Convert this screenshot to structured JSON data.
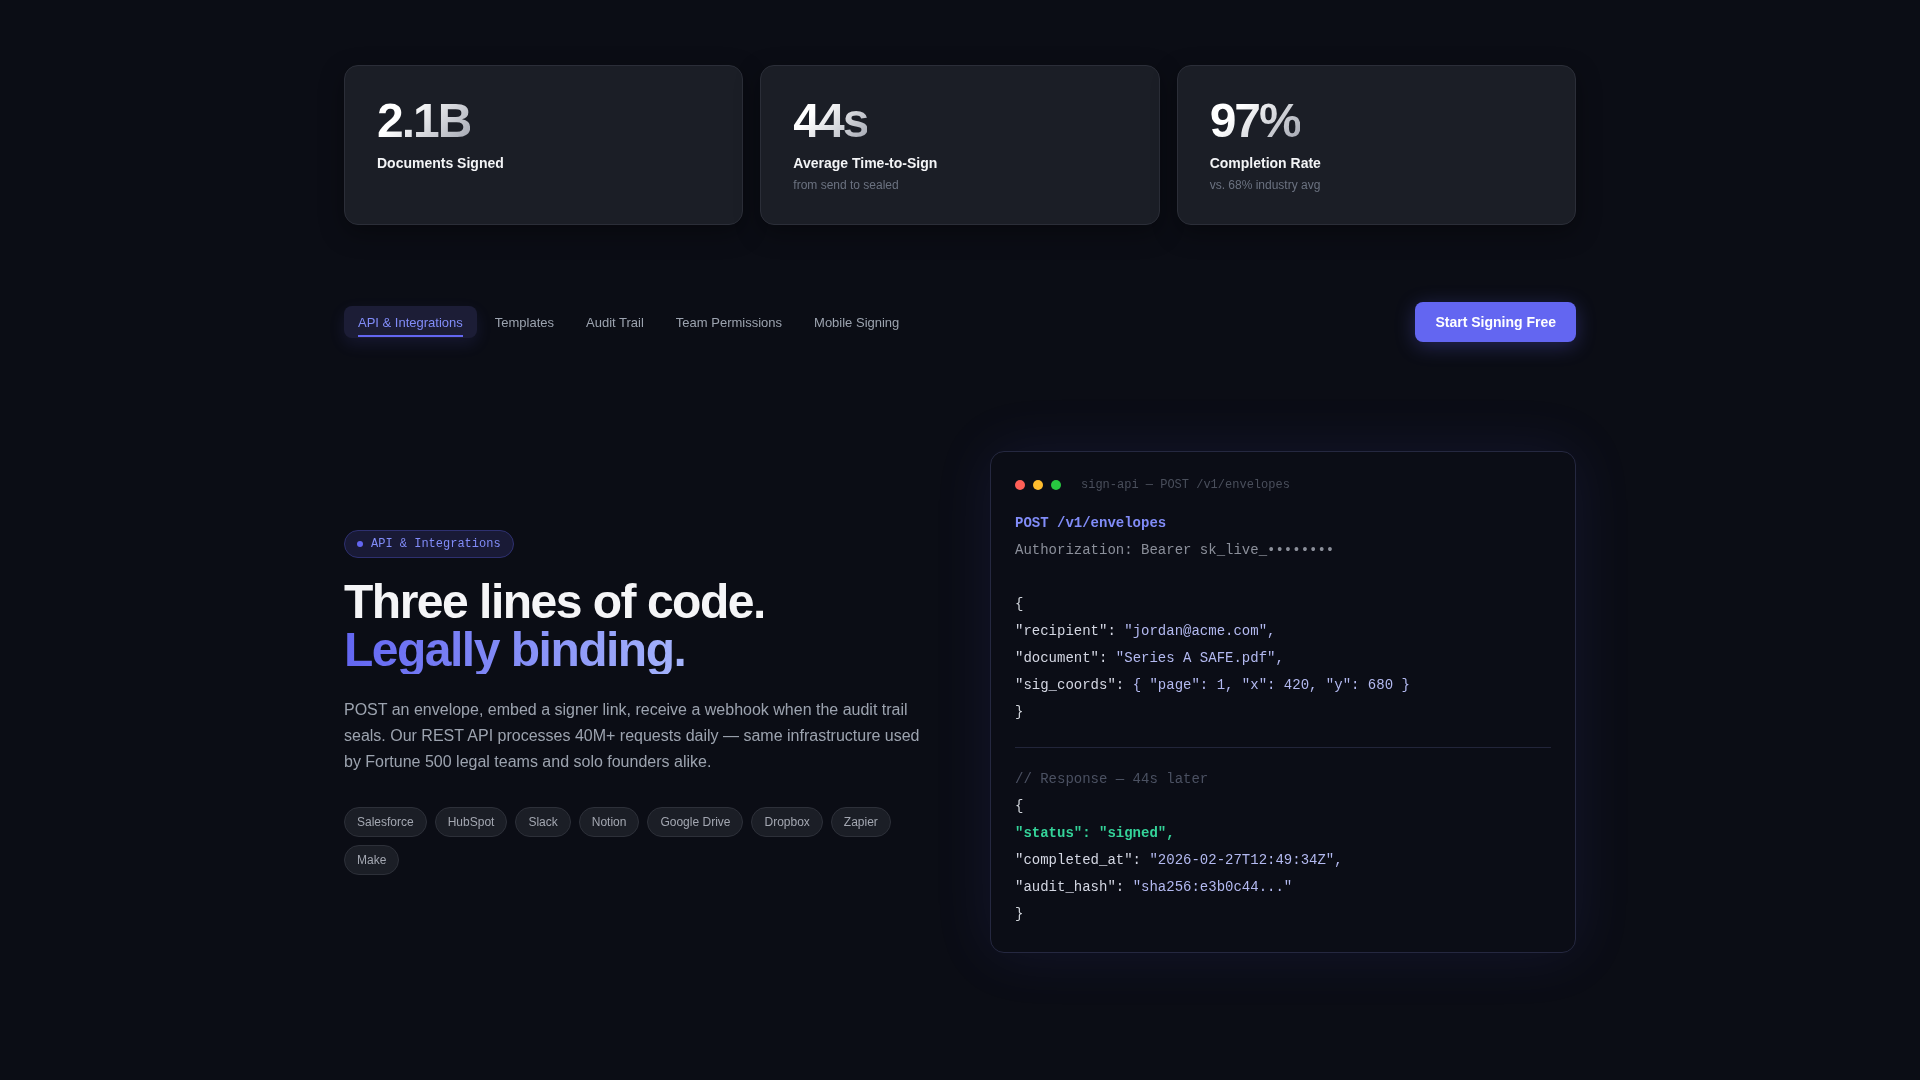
{
  "stats": [
    {
      "value": "2.1B",
      "label": "Documents Signed"
    },
    {
      "value": "44s",
      "label": "Average Time-to-Sign",
      "note": "from send to sealed"
    },
    {
      "value": "97%",
      "label": "Completion Rate",
      "note": "vs. 68% industry avg"
    }
  ],
  "tabs": [
    {
      "label": "API & Integrations",
      "selected": true
    },
    {
      "label": "Templates",
      "selected": false
    },
    {
      "label": "Audit Trail",
      "selected": false
    },
    {
      "label": "Team Permissions",
      "selected": false
    },
    {
      "label": "Mobile Signing",
      "selected": false
    }
  ],
  "cta": {
    "label": "Start Signing Free"
  },
  "hero": {
    "badge": "API & Integrations",
    "headline": "Three lines of code.",
    "headline_accent": "Legally binding.",
    "description": "POST an envelope, embed a signer link, receive a webhook when the audit trail seals. Our REST API processes 40M+ requests daily — same infrastructure used by Fortune 500 legal teams and solo founders alike.",
    "integrations": [
      "Salesforce",
      "HubSpot",
      "Slack",
      "Notion",
      "Google Drive",
      "Dropbox",
      "Zapier",
      "Make"
    ]
  },
  "code_window": {
    "title": "sign-api — POST /v1/envelopes",
    "lines": [
      {
        "kind": "request",
        "text": "POST /v1/envelopes"
      },
      {
        "kind": "header",
        "text": "Authorization: Bearer sk_live_••••••••"
      },
      {
        "kind": "blank"
      },
      {
        "kind": "plain",
        "text": "{"
      },
      {
        "kind": "pair",
        "key": "\"recipient\":",
        "value": "\"jordan@acme.com\","
      },
      {
        "kind": "pair",
        "key": "\"document\":",
        "value": "\"Series A SAFE.pdf\","
      },
      {
        "kind": "pair",
        "key": "\"sig_coords\":",
        "value": "{ \"page\": 1, \"x\": 420, \"y\": 680 }"
      },
      {
        "kind": "plain",
        "text": "}"
      },
      {
        "kind": "divider"
      },
      {
        "kind": "comment",
        "text": "// Response — 44s later"
      },
      {
        "kind": "plain",
        "text": "{"
      },
      {
        "kind": "success",
        "text": "\"status\": \"signed\","
      },
      {
        "kind": "pair",
        "key": "\"completed_at\":",
        "value": "\"2026-02-27T12:49:34Z\","
      },
      {
        "kind": "pair",
        "key": "\"audit_hash\":",
        "value": "\"sha256:e3b0c44...\""
      },
      {
        "kind": "plain",
        "text": "}"
      }
    ]
  }
}
